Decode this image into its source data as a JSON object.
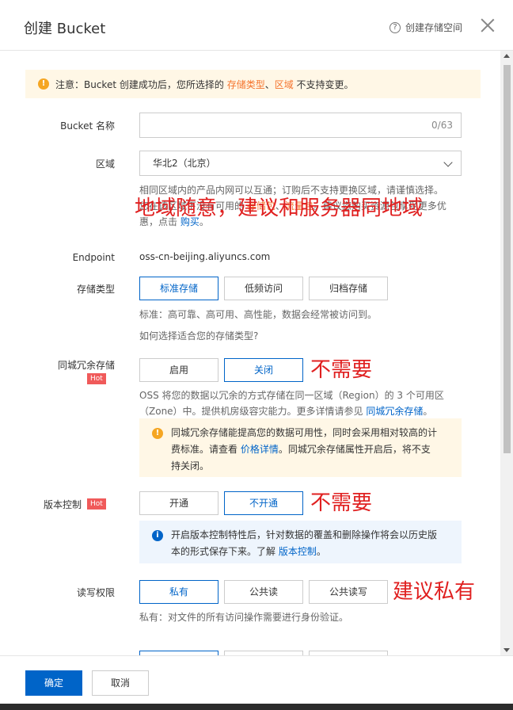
{
  "header": {
    "title": "创建 Bucket",
    "help_label": "创建存储空间"
  },
  "notice": {
    "prefix": "注意：Bucket 创建成功后，您所选择的 ",
    "storage_type": "存储类型",
    "sep": "、",
    "region": "区域",
    "suffix": " 不支持变更。"
  },
  "bucket_name": {
    "label": "Bucket 名称",
    "value": "",
    "count": "0/63"
  },
  "region": {
    "label": "区域",
    "selected": "华北2（北京）",
    "hint_line1": "相同区域内的产品内网可以互通；订购后不支持更换区域，请谨慎选择。",
    "hint_line2_prefix": "您在该区域下没有可用的 ",
    "hint_pkg": "存储包",
    "hint_sep": "、",
    "hint_flow": "流量包",
    "hint_line2_suffix": "。建议您购买资源包享受更多优",
    "hint_line3_prefix": "惠，点击 ",
    "hint_buy": "购买",
    "hint_line3_suffix": "。"
  },
  "endpoint": {
    "label": "Endpoint",
    "value": "oss-cn-beijing.aliyuncs.com"
  },
  "storage_type": {
    "label": "存储类型",
    "options": [
      "标准存储",
      "低频访问",
      "归档存储"
    ],
    "desc": "标准：高可靠、高可用、高性能，数据会经常被访问到。",
    "link": "如何选择适合您的存储类型?"
  },
  "zone_redundancy": {
    "label": "同城冗余存储",
    "hot": "Hot",
    "options": [
      "启用",
      "关闭"
    ],
    "desc_line1": "OSS 将您的数据以冗余的方式存储在同一区域（Region）的 3 个可用区",
    "desc_line2_prefix": "（Zone）中。提供机房级容灾能力。更多详情请参见 ",
    "desc_link": "同城冗余存储",
    "desc_line2_suffix": "。",
    "warn_line1": "同城冗余存储能提高您的数据可用性，同时会采用相对较高的计",
    "warn_line2_prefix": "费标准。请查看 ",
    "warn_link": "价格详情",
    "warn_line2_suffix": "。同城冗余存储属性开启后，将不支",
    "warn_line3": "持关闭。"
  },
  "versioning": {
    "label": "版本控制",
    "hot": "Hot",
    "options": [
      "开通",
      "不开通"
    ],
    "info_line1": "开启版本控制特性后，针对数据的覆盖和删除操作将会以历史版",
    "info_line2_prefix": "本的形式保存下来。了解 ",
    "info_link": "版本控制",
    "info_line2_suffix": "。"
  },
  "acl": {
    "label": "读写权限",
    "options": [
      "私有",
      "公共读",
      "公共读写"
    ],
    "desc": "私有：对文件的所有访问操作需要进行身份验证。"
  },
  "annotations": {
    "region": "地域随意，建议和服务器同地域",
    "redundancy": "不需要",
    "versioning": "不需要",
    "acl": "建议私有"
  },
  "footer": {
    "ok": "确定",
    "cancel": "取消"
  },
  "colors": {
    "primary": "#0064c8",
    "orange": "#f5742d",
    "annotation": "#e02020",
    "warn_bg": "#fff7e6",
    "info_bg": "#eef5fd"
  }
}
